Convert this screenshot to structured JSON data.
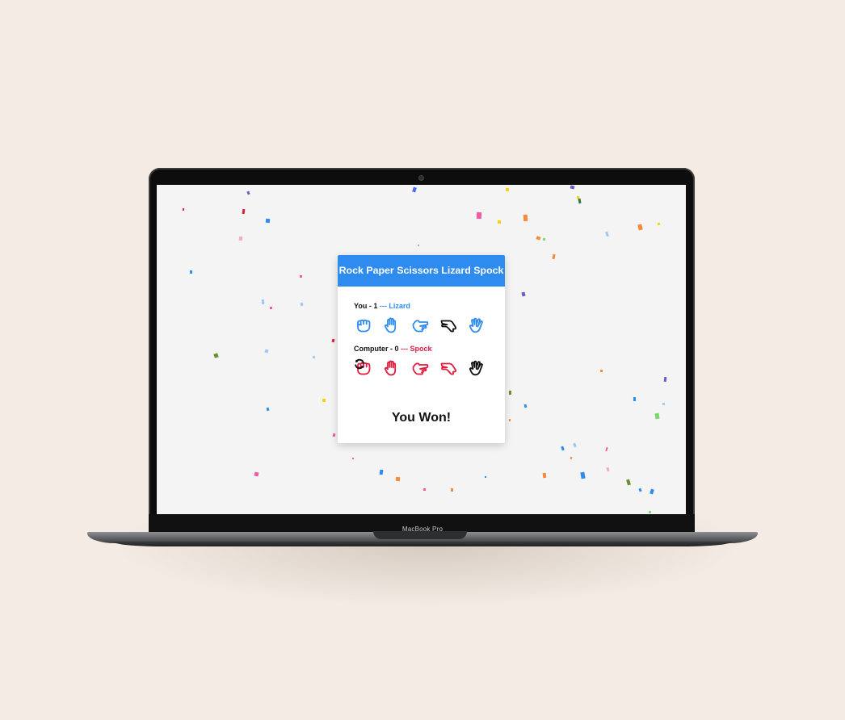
{
  "device": {
    "label": "MacBook Pro"
  },
  "game": {
    "title": "Rock Paper Scissors Lizard Spock",
    "you": {
      "label": "You - 1",
      "separator": "---",
      "choice": "Lizard"
    },
    "computer": {
      "label": "Computer - 0",
      "separator": "---",
      "choice": "Spock"
    },
    "result": "You Won!",
    "options": [
      "Rock",
      "Paper",
      "Scissors",
      "Lizard",
      "Spock"
    ],
    "icons": [
      "rock-icon",
      "paper-icon",
      "scissors-icon",
      "lizard-icon",
      "spock-icon"
    ]
  },
  "colors": {
    "header": "#2e8cf0",
    "you": "#2e8cf0",
    "computer": "#e01b3c",
    "selected": "#111111"
  }
}
